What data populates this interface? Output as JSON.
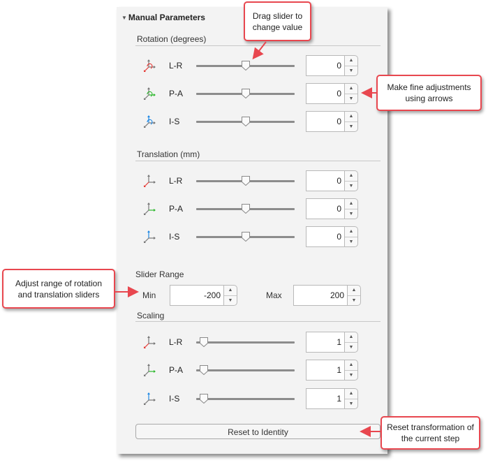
{
  "panel": {
    "title": "Manual Parameters",
    "collapse_icon": "triangle-down-icon"
  },
  "rotation": {
    "title": "Rotation (degrees)",
    "rows": [
      {
        "label": "L-R",
        "value": "0",
        "slider_fraction": 0.5,
        "icon": "rotate-lr-icon",
        "axis_color": "#e53935"
      },
      {
        "label": "P-A",
        "value": "0",
        "slider_fraction": 0.5,
        "icon": "rotate-pa-icon",
        "axis_color": "#2eb82e"
      },
      {
        "label": "I-S",
        "value": "0",
        "slider_fraction": 0.5,
        "icon": "rotate-is-icon",
        "axis_color": "#1e88e5"
      }
    ]
  },
  "translation": {
    "title": "Translation (mm)",
    "rows": [
      {
        "label": "L-R",
        "value": "0",
        "slider_fraction": 0.5,
        "icon": "translate-lr-icon",
        "axis_color": "#e53935"
      },
      {
        "label": "P-A",
        "value": "0",
        "slider_fraction": 0.5,
        "icon": "translate-pa-icon",
        "axis_color": "#2eb82e"
      },
      {
        "label": "I-S",
        "value": "0",
        "slider_fraction": 0.5,
        "icon": "translate-is-icon",
        "axis_color": "#1e88e5"
      }
    ]
  },
  "slider_range": {
    "title": "Slider Range",
    "min_label": "Min",
    "min_value": "-200",
    "max_label": "Max",
    "max_value": "200"
  },
  "scaling": {
    "title": "Scaling",
    "rows": [
      {
        "label": "L-R",
        "value": "1",
        "slider_fraction": 0.08,
        "icon": "scale-lr-icon",
        "axis_color": "#e53935"
      },
      {
        "label": "P-A",
        "value": "1",
        "slider_fraction": 0.08,
        "icon": "scale-pa-icon",
        "axis_color": "#2eb82e"
      },
      {
        "label": "I-S",
        "value": "1",
        "slider_fraction": 0.08,
        "icon": "scale-is-icon",
        "axis_color": "#1e88e5"
      }
    ]
  },
  "reset_button": {
    "label": "Reset to Identity"
  },
  "callouts": {
    "drag_slider": "Drag slider to change value",
    "fine_adjust": "Make fine adjustments using arrows",
    "adjust_range": "Adjust range of rotation and translation sliders",
    "reset": "Reset transformation of the current step"
  },
  "colors": {
    "callout_border": "#e8474f",
    "panel_bg": "#f3f3f3"
  }
}
